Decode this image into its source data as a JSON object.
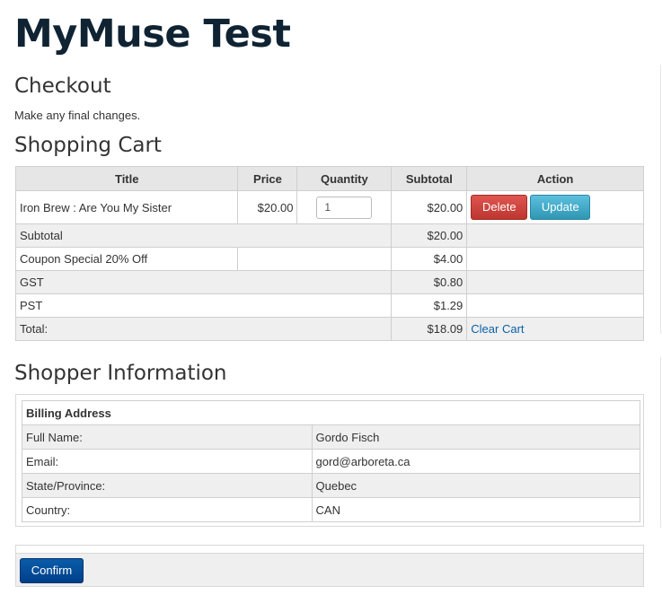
{
  "site": {
    "title": "MyMuse Test"
  },
  "checkout": {
    "heading": "Checkout",
    "lead": "Make any final changes."
  },
  "cart": {
    "heading": "Shopping Cart",
    "columns": {
      "title": "Title",
      "price": "Price",
      "quantity": "Quantity",
      "subtotal": "Subtotal",
      "action": "Action"
    },
    "item": {
      "title": "Iron Brew : Are You My Sister",
      "price": "$20.00",
      "quantity": "1",
      "subtotal": "$20.00",
      "delete_label": "Delete",
      "update_label": "Update"
    },
    "summary": {
      "subtotal_label": "Subtotal",
      "subtotal_value": "$20.00",
      "coupon_label": "Coupon Special 20% Off",
      "coupon_value": "$4.00",
      "gst_label": "GST",
      "gst_value": "$0.80",
      "pst_label": "PST",
      "pst_value": "$1.29",
      "total_label": "Total:",
      "total_value": "$18.09",
      "clear_cart_label": "Clear Cart"
    }
  },
  "shopper": {
    "heading": "Shopper Information",
    "billing_heading": "Billing Address",
    "rows": [
      {
        "label": "Full Name:",
        "value": "Gordo Fisch"
      },
      {
        "label": "Email:",
        "value": "gord@arboreta.ca"
      },
      {
        "label": "State/Province:",
        "value": "Quebec"
      },
      {
        "label": "Country:",
        "value": "CAN"
      }
    ]
  },
  "actions": {
    "confirm_label": "Confirm"
  },
  "colors": {
    "title": "#0f2333",
    "link": "#0a62a6",
    "delete": "#bd362f",
    "update": "#2f96b4",
    "confirm": "#003f8a"
  }
}
